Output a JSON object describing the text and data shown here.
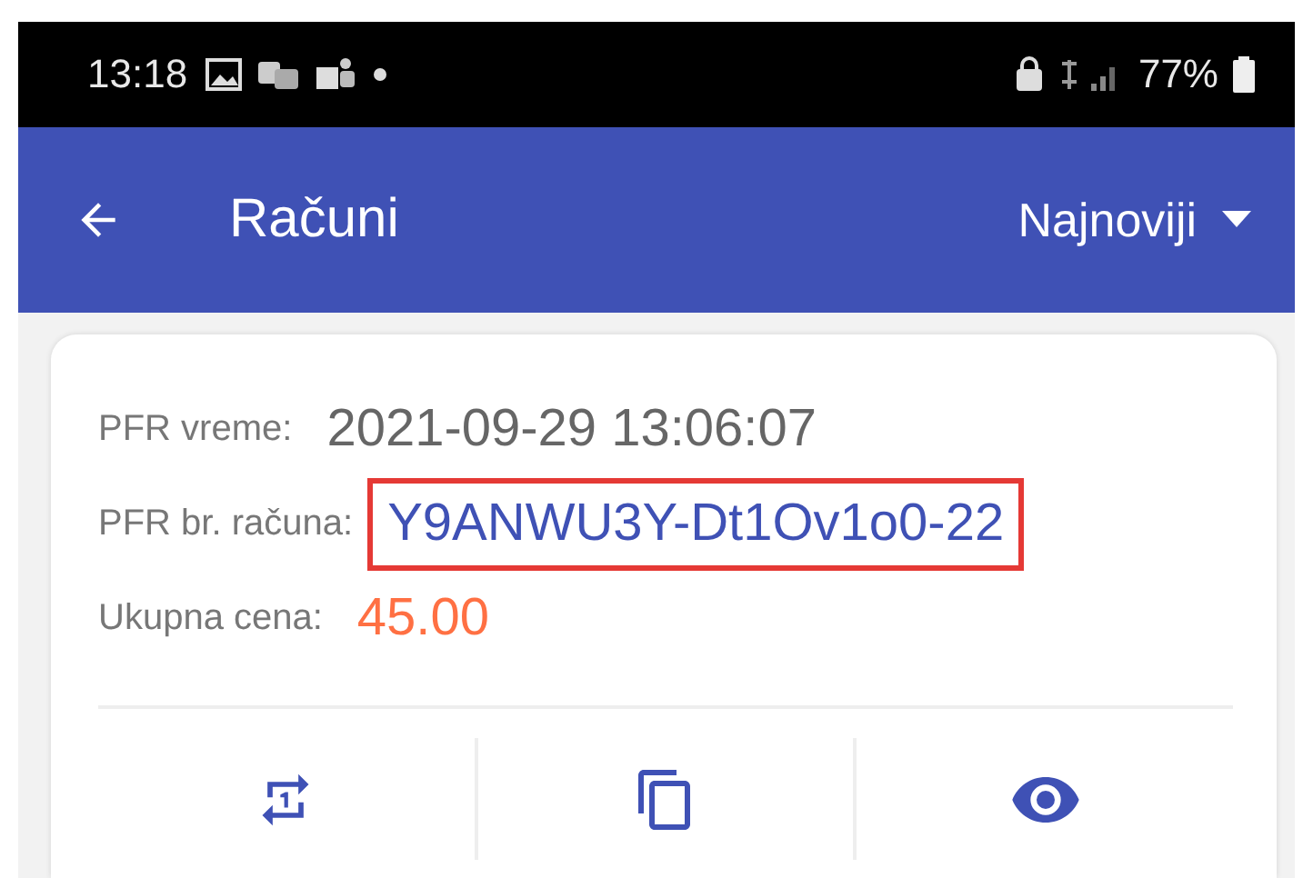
{
  "status_bar": {
    "time": "13:18",
    "battery": "77%"
  },
  "app_bar": {
    "title": "Računi",
    "sort": "Najnoviji"
  },
  "receipt": {
    "fields": [
      {
        "label": "PFR vreme:",
        "value": "2021-09-29 13:06:07",
        "kind": "plain",
        "highlighted": false
      },
      {
        "label": "PFR br. računa:",
        "value": "Y9ANWU3Y-Dt1Ov1o0-22",
        "kind": "link",
        "highlighted": true
      },
      {
        "label": "Ukupna cena:",
        "value": "45.00",
        "kind": "price",
        "highlighted": false
      }
    ]
  }
}
